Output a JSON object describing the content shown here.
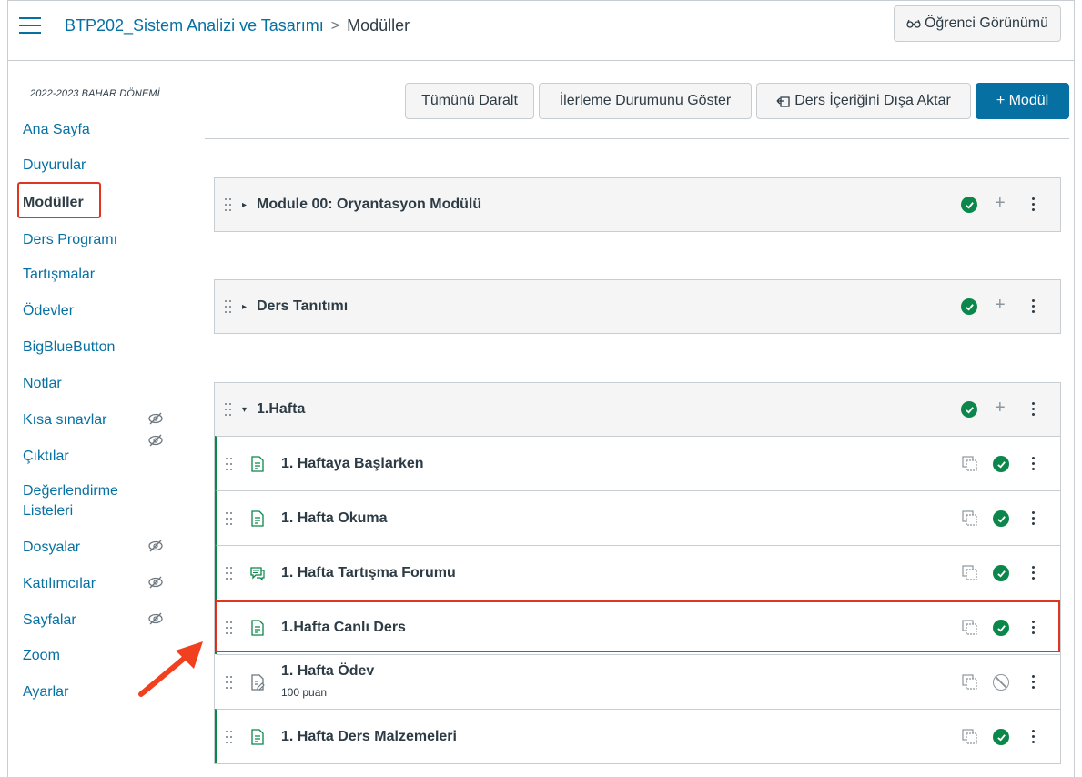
{
  "header": {
    "course_link": "BTP202_Sistem Analizi ve Tasarımı",
    "separator": ">",
    "current_page": "Modüller",
    "student_view_label": "Öğrenci Görünümü"
  },
  "sidebar": {
    "term": "2022-2023 BAHAR DÖNEMİ",
    "items": [
      {
        "label": "Ana Sayfa"
      },
      {
        "label": "Duyurular"
      },
      {
        "label": "Modüller"
      },
      {
        "label": "Ders Programı"
      },
      {
        "label": "Tartışmalar"
      },
      {
        "label": "Ödevler"
      },
      {
        "label": "BigBlueButton"
      },
      {
        "label": "Notlar"
      },
      {
        "label": "Kısa sınavlar"
      },
      {
        "label": "Çıktılar"
      },
      {
        "label": "Değerlendirme"
      },
      {
        "label": "Listeleri"
      },
      {
        "label": "Dosyalar"
      },
      {
        "label": "Katılımcılar"
      },
      {
        "label": "Sayfalar"
      },
      {
        "label": "Zoom"
      },
      {
        "label": "Ayarlar"
      }
    ]
  },
  "toolbar": {
    "collapse_all": "Tümünü Daralt",
    "show_progress": "İlerleme Durumunu Göster",
    "export": "Ders İçeriğini Dışa Aktar",
    "add_module": "+ Modül"
  },
  "modules": [
    {
      "title": "Module 00: Oryantasyon Modülü",
      "expanded": false
    },
    {
      "title": "Ders Tanıtımı",
      "expanded": false
    },
    {
      "title": "1.Hafta",
      "expanded": true,
      "items": [
        {
          "title": "1. Haftaya Başlarken",
          "type": "page",
          "published": true
        },
        {
          "title": "1. Hafta Okuma",
          "type": "page",
          "published": true
        },
        {
          "title": "1. Hafta Tartışma Forumu",
          "type": "discussion",
          "published": true
        },
        {
          "title": "1.Hafta Canlı Ders",
          "type": "page",
          "published": true
        },
        {
          "title": "1. Hafta Ödev",
          "subtitle": "100 puan",
          "type": "assignment",
          "published": false
        },
        {
          "title": "1. Hafta Ders Malzemeleri",
          "type": "page",
          "published": true
        }
      ]
    }
  ],
  "colors": {
    "link": "#0770a3",
    "published": "#0b874b",
    "highlight": "#e0351f",
    "border": "#c7cdd1"
  }
}
